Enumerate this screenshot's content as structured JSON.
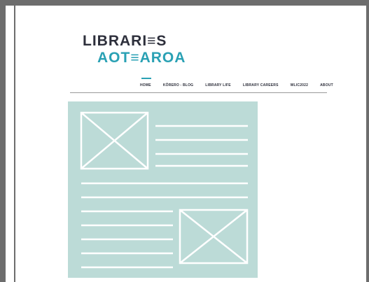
{
  "logo": {
    "line1": "LIBRARI≡S",
    "line2": "AOT≡AROA"
  },
  "nav": {
    "items": [
      "HOME",
      "KŌRERO - BLOG",
      "LIBRARY LIFE",
      "LIBRARY CAREERS",
      "WLIC2022",
      "ABOUT"
    ],
    "active": "HOME"
  },
  "colors": {
    "accent": "#2aa1b4",
    "wireframe_bg": "#bcdbd7",
    "frame": "#6d6d6d"
  },
  "wireframe": {
    "image_placeholder_icon": "crossed-box-icon",
    "text_placeholder_icon": "line-icon"
  }
}
